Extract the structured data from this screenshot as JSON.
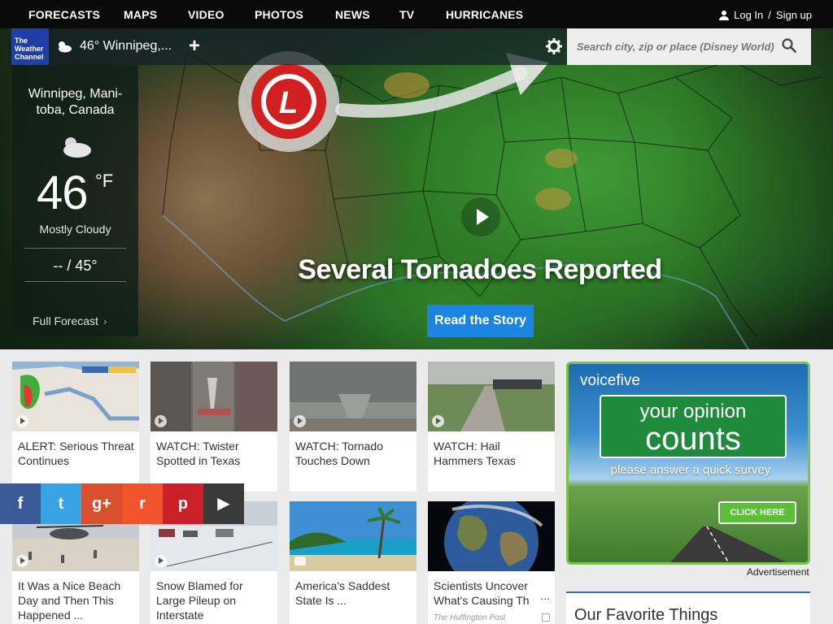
{
  "nav": {
    "items": [
      "FORECASTS",
      "MAPS",
      "VIDEO",
      "PHOTOS",
      "NEWS",
      "TV",
      "HURRICANES"
    ],
    "login": "Log In",
    "separator": "/",
    "signup": "Sign up"
  },
  "subnav": {
    "logo_line1": "The",
    "logo_line2": "Weather",
    "logo_line3": "Channel",
    "location_temp": "46° Winnipeg,...",
    "add_label": "+",
    "search_placeholder": "Search city, zip or place (Disney World)"
  },
  "conditions": {
    "city": "Winnipeg, Mani- toba, Canada",
    "temp": "46",
    "unit": "°F",
    "phrase": "Mostly Cloudy",
    "hilo": "-- / 45°",
    "full_forecast": "Full Forecast",
    "chevron": "›"
  },
  "hero": {
    "headline": "Several Tornadoes Reported",
    "cta": "Read the Story"
  },
  "cards": [
    {
      "caption": "ALERT: Serious Threat Continues",
      "media": "video"
    },
    {
      "caption": "WATCH: Twister Spotted in Texas",
      "media": "video"
    },
    {
      "caption": "WATCH: Tornado Touches Down",
      "media": "video"
    },
    {
      "caption": "WATCH: Hail Hammers Texas",
      "media": "video"
    },
    {
      "caption": "It Was a Nice Beach Day and Then This Happened ...",
      "media": "video"
    },
    {
      "caption": "Snow Blamed for Large Pileup on Interstate",
      "media": "video"
    },
    {
      "caption": "America's Saddest State Is ...",
      "media": "photo"
    },
    {
      "caption": "Scientists Uncover What's Causing Th",
      "media": "none",
      "source": "The Huffington Post",
      "more": "..."
    }
  ],
  "share": {
    "facebook": "f",
    "twitter": "t",
    "googleplus": "g+",
    "reddit": "r",
    "pinterest": "p",
    "more": "▶"
  },
  "ad": {
    "brand": "voicefive",
    "line1": "your opinion",
    "line2": "counts",
    "survey": "please answer a quick survey",
    "click": "CLICK HERE",
    "label": "Advertisement"
  },
  "favorites": {
    "title": "Our Favorite Things"
  },
  "colors": {
    "nav_bg": "#0a0a0a",
    "accent_blue": "#1a84e0",
    "logo_blue": "#1f3fa6",
    "ad_green": "#7cc24c"
  }
}
